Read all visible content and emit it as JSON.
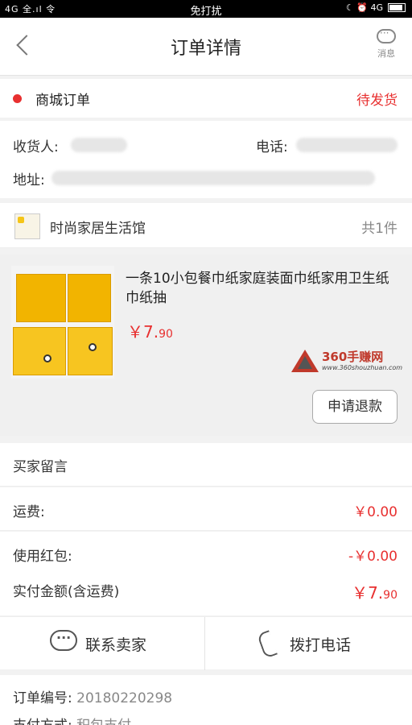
{
  "statusbar": {
    "left": "4G 全.ıl 令",
    "mode": "免打扰",
    "right": "☾ ⏰ 4G"
  },
  "nav": {
    "title": "订单详情",
    "message_label": "消息"
  },
  "order": {
    "type": "商城订单",
    "status": "待发货",
    "status_color": "#e83030"
  },
  "address": {
    "receiver_label": "收货人:",
    "phone_label": "电话:",
    "address_label": "地址:"
  },
  "shop": {
    "name": "时尚家居生活馆",
    "count": "共1件",
    "logo_text": "时尚家居生活馆"
  },
  "product": {
    "title": "一条10小包餐巾纸家庭装面巾纸家用卫生纸巾纸抽",
    "price_big": "￥7.",
    "price_small": "90",
    "refund_label": "申请退款",
    "watermark_name": "360手赚网",
    "watermark_url": "www.360shouzhuan.com"
  },
  "remark": {
    "label": "买家留言"
  },
  "fees": {
    "shipping_label": "运费:",
    "shipping_value": "￥0.00",
    "redpack_label": "使用红包:",
    "redpack_value": "-￥0.00",
    "total_label": "实付金额(含运费)",
    "total_big": "￥7.",
    "total_small": "90"
  },
  "actions": {
    "contact_label": "联系卖家",
    "call_label": "拨打电话"
  },
  "info": {
    "order_no_label": "订单编号:",
    "order_no_value": "20180220298",
    "pay_label": "支付方式:",
    "pay_value": "积包支付"
  },
  "colors": {
    "accent": "#e83030"
  }
}
